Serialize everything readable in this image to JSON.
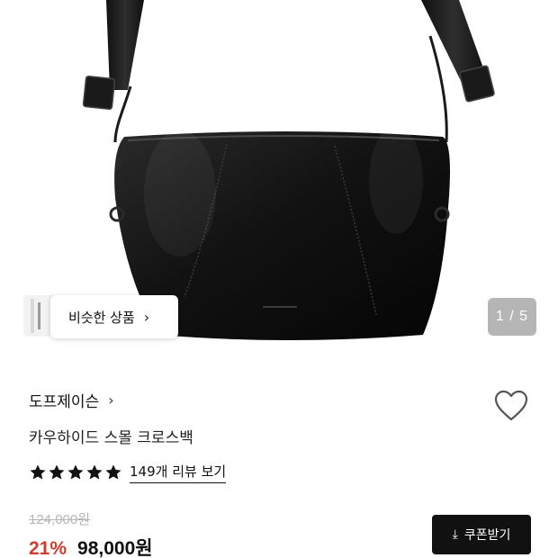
{
  "hero": {
    "similar_button_label": "비슷한 상품",
    "page_indicator": "1 / 5"
  },
  "product": {
    "brand": "도프제이슨",
    "name": "카우하이드 스몰 크로스백",
    "rating_stars": 5,
    "review_link": "149개 리뷰 보기",
    "original_price": "124,000원",
    "discount_rate": "21%",
    "sale_price": "98,000원"
  },
  "actions": {
    "coupon_button_label": "쿠폰받기"
  },
  "icons": {
    "brand_chevron": "chevron-right-icon",
    "wishlist": "heart-icon",
    "star": "star-icon",
    "coupon": "download-icon"
  },
  "colors": {
    "discount": "#d43b2f",
    "button_bg": "#111111",
    "original_price": "#b5b5b5"
  }
}
